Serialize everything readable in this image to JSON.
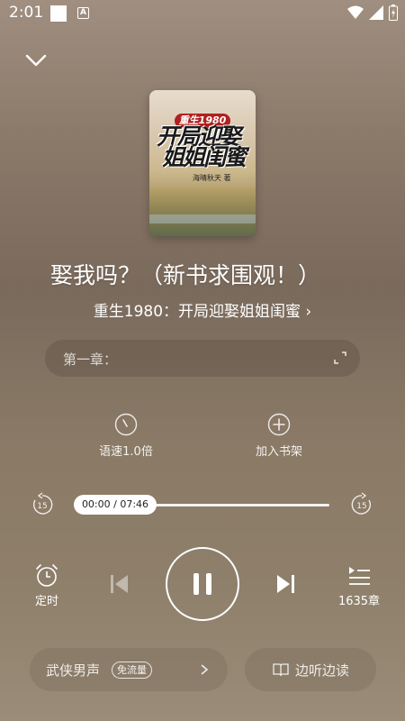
{
  "status_bar": {
    "time": "2:01",
    "app_badge": "A"
  },
  "cover": {
    "badge": "重生1980",
    "title_line1": "开局迎娶",
    "title_line2": "姐姐闺蜜",
    "author": "海晴秋天 著"
  },
  "episode_title": "娶我吗？（新书求围观！）",
  "book_name": "重生1980：开局迎娶姐姐闺蜜 ›",
  "chapter_bar": {
    "label": "第一章："
  },
  "actions": {
    "speed_label": "语速1.0倍",
    "add_shelf_label": "加入书架"
  },
  "player": {
    "time_display": "00:00 / 07:46",
    "progress": 0.0,
    "skip_seconds": "15"
  },
  "controls": {
    "timer_label": "定时",
    "chapters_label": "1635章"
  },
  "bottom": {
    "voice_label": "武侠男声",
    "free_badge": "免流量",
    "listen_label": "边听边读"
  }
}
